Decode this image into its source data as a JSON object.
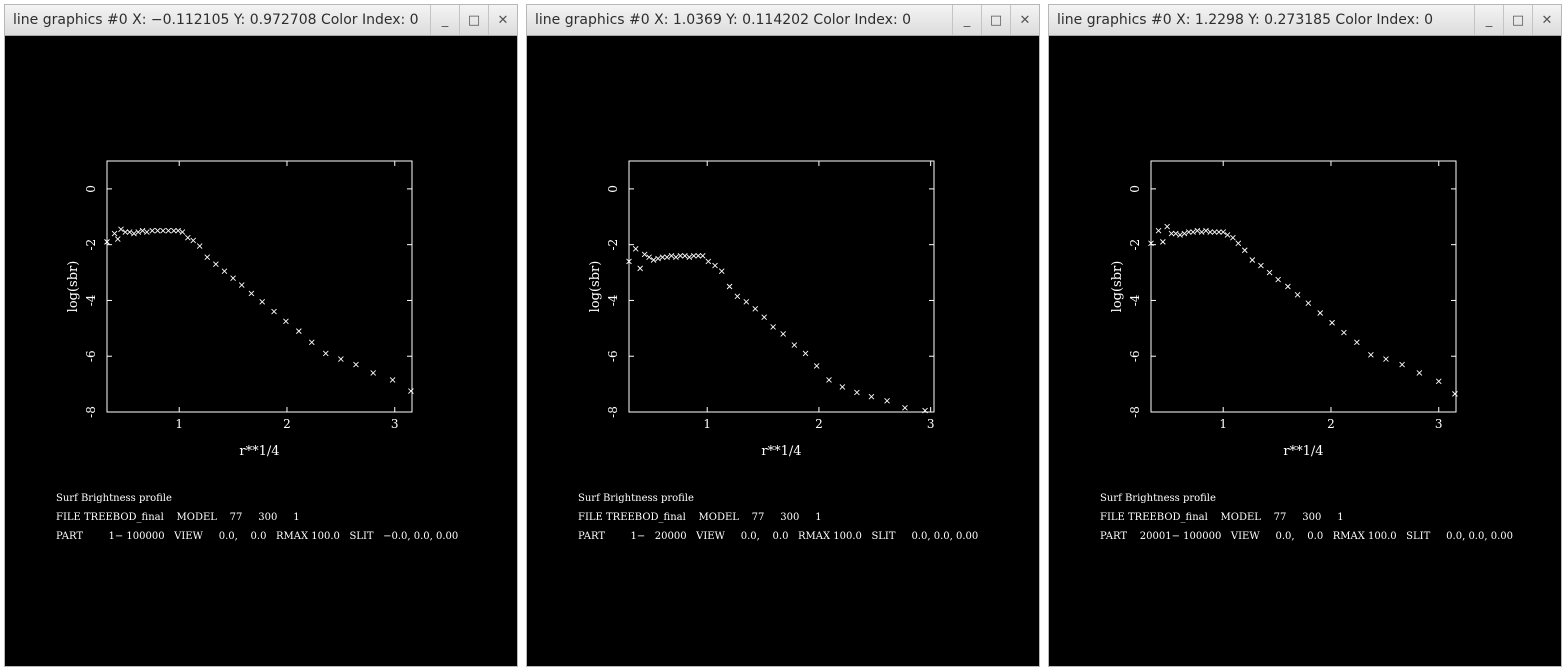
{
  "windows": [
    {
      "title": "line graphics #0 X: −0.112105 Y: 0.972708 Color Index: 0",
      "controls": {
        "minimize": "_",
        "maximize": "□",
        "close": "✕"
      },
      "info_lines": [
        "Surf Brightness profile",
        "FILE TREEBOD_final    MODEL    77     300     1",
        "PART        1− 100000   VIEW     0.0,    0.0   RMAX 100.0   SLIT   −0.0, 0.0, 0.00"
      ],
      "chart_data": {
        "type": "scatter",
        "marker": "x",
        "xlabel": "r**1/4",
        "ylabel": "log(sbr)",
        "xlim": [
          0.33,
          3.16
        ],
        "ylim": [
          -8,
          1
        ],
        "xticks": [
          1,
          2,
          3
        ],
        "yticks": [
          0,
          -2,
          -4,
          -6,
          -8
        ],
        "x": [
          0.33,
          0.4,
          0.43,
          0.46,
          0.5,
          0.54,
          0.58,
          0.62,
          0.66,
          0.7,
          0.75,
          0.8,
          0.85,
          0.9,
          0.95,
          0.99,
          1.03,
          1.08,
          1.13,
          1.19,
          1.26,
          1.34,
          1.42,
          1.5,
          1.58,
          1.67,
          1.77,
          1.88,
          1.99,
          2.11,
          2.23,
          2.36,
          2.5,
          2.64,
          2.8,
          2.98,
          3.15
        ],
        "y": [
          -1.9,
          -1.6,
          -1.8,
          -1.45,
          -1.55,
          -1.55,
          -1.6,
          -1.55,
          -1.5,
          -1.55,
          -1.5,
          -1.5,
          -1.5,
          -1.5,
          -1.5,
          -1.5,
          -1.55,
          -1.75,
          -1.85,
          -2.05,
          -2.45,
          -2.7,
          -2.95,
          -3.2,
          -3.45,
          -3.75,
          -4.05,
          -4.4,
          -4.75,
          -5.1,
          -5.5,
          -5.9,
          -6.1,
          -6.3,
          -6.6,
          -6.85,
          -7.25
        ]
      }
    },
    {
      "title": "line graphics #0 X: 1.0369 Y: 0.114202 Color Index: 0",
      "controls": {
        "minimize": "_",
        "maximize": "□",
        "close": "✕"
      },
      "info_lines": [
        "Surf Brightness profile",
        "FILE TREEBOD_final    MODEL    77     300     1",
        "PART        1−   20000   VIEW     0.0,    0.0   RMAX 100.0   SLIT     0.0, 0.0, 0.00"
      ],
      "chart_data": {
        "type": "scatter",
        "marker": "x",
        "xlabel": "r**1/4",
        "ylabel": "log(sbr)",
        "xlim": [
          0.3,
          3.03
        ],
        "ylim": [
          -8,
          1
        ],
        "xticks": [
          1,
          2,
          3
        ],
        "yticks": [
          0,
          -2,
          -4,
          -6,
          -8
        ],
        "x": [
          0.3,
          0.36,
          0.4,
          0.44,
          0.48,
          0.52,
          0.56,
          0.6,
          0.64,
          0.68,
          0.72,
          0.76,
          0.8,
          0.84,
          0.88,
          0.92,
          0.96,
          1.01,
          1.07,
          1.13,
          1.2,
          1.27,
          1.35,
          1.43,
          1.51,
          1.59,
          1.68,
          1.78,
          1.88,
          1.98,
          2.09,
          2.21,
          2.34,
          2.47,
          2.61,
          2.77,
          2.95
        ],
        "y": [
          -2.6,
          -2.15,
          -2.85,
          -2.35,
          -2.45,
          -2.55,
          -2.5,
          -2.45,
          -2.45,
          -2.4,
          -2.45,
          -2.4,
          -2.4,
          -2.45,
          -2.4,
          -2.4,
          -2.4,
          -2.6,
          -2.75,
          -2.95,
          -3.5,
          -3.85,
          -4.05,
          -4.3,
          -4.6,
          -4.95,
          -5.2,
          -5.6,
          -5.9,
          -6.35,
          -6.85,
          -7.1,
          -7.3,
          -7.45,
          -7.6,
          -7.85,
          -7.95
        ]
      }
    },
    {
      "title": "line graphics #0 X: 1.2298 Y: 0.273185 Color Index: 0",
      "controls": {
        "minimize": "_",
        "maximize": "□",
        "close": "✕"
      },
      "info_lines": [
        "Surf Brightness profile",
        "FILE TREEBOD_final    MODEL    77     300     1",
        "PART    20001− 100000   VIEW     0.0,    0.0   RMAX 100.0   SLIT     0.0, 0.0, 0.00"
      ],
      "chart_data": {
        "type": "scatter",
        "marker": "x",
        "xlabel": "r**1/4",
        "ylabel": "log(sbr)",
        "xlim": [
          0.33,
          3.16
        ],
        "ylim": [
          -8,
          1
        ],
        "xticks": [
          1,
          2,
          3
        ],
        "yticks": [
          0,
          -2,
          -4,
          -6,
          -8
        ],
        "x": [
          0.33,
          0.4,
          0.44,
          0.48,
          0.52,
          0.56,
          0.6,
          0.64,
          0.68,
          0.72,
          0.76,
          0.8,
          0.84,
          0.88,
          0.92,
          0.96,
          1.0,
          1.04,
          1.09,
          1.14,
          1.2,
          1.27,
          1.35,
          1.43,
          1.51,
          1.6,
          1.69,
          1.79,
          1.9,
          2.01,
          2.12,
          2.24,
          2.37,
          2.51,
          2.66,
          2.82,
          3.0,
          3.15
        ],
        "y": [
          -1.95,
          -1.5,
          -1.9,
          -1.35,
          -1.6,
          -1.6,
          -1.65,
          -1.6,
          -1.55,
          -1.55,
          -1.5,
          -1.55,
          -1.5,
          -1.55,
          -1.55,
          -1.55,
          -1.55,
          -1.65,
          -1.75,
          -1.95,
          -2.2,
          -2.55,
          -2.75,
          -3.0,
          -3.25,
          -3.5,
          -3.8,
          -4.1,
          -4.45,
          -4.8,
          -5.15,
          -5.5,
          -5.95,
          -6.1,
          -6.3,
          -6.6,
          -6.9,
          -7.35
        ]
      }
    }
  ]
}
